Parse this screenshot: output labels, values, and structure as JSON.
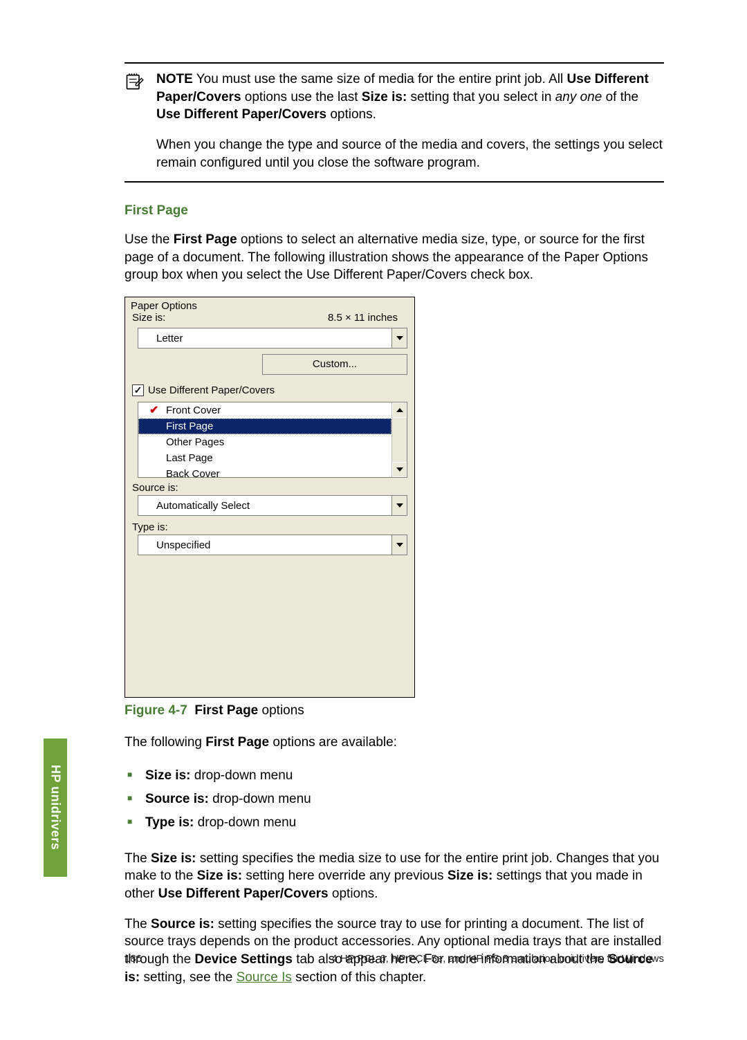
{
  "note": {
    "label": "NOTE",
    "para1_pre": "   You must use the same size of media for the entire print job. All ",
    "bold1": "Use Different Paper/Covers",
    "mid1": " options use the last ",
    "bold2": "Size is:",
    "mid2": " setting that you select in ",
    "ital1": "any one",
    "mid3": " of the ",
    "bold3": "Use Different Paper/Covers",
    "end1": " options.",
    "para2": "When you change the type and source of the media and covers, the settings you select remain configured until you close the software program."
  },
  "section": {
    "heading": "First Page"
  },
  "intro": {
    "pre": "Use the ",
    "b1": "First Page",
    "rest": " options to select an alternative media size, type, or source for the first page of a document. The following illustration shows the appearance of the Paper Options group box when you select the Use Different Paper/Covers check box."
  },
  "dialog": {
    "group": "Paper Options",
    "size_label": "Size is:",
    "size_dim": "8.5 × 11 inches",
    "size_value": "Letter",
    "custom_btn": "Custom...",
    "check_label": "Use Different Paper/Covers",
    "list": {
      "items": [
        "Front Cover",
        "First Page",
        "Other Pages",
        "Last Page",
        "Back Cover"
      ],
      "selected_index": 1,
      "checked_index": 0
    },
    "source_label": "Source is:",
    "source_value": "Automatically Select",
    "type_label": "Type is:",
    "type_value": "Unspecified"
  },
  "figure": {
    "label": "Figure 4-7",
    "title_bold": "First Page",
    "title_rest": " options"
  },
  "avail": {
    "pre": "The following ",
    "b1": "First Page",
    "rest": " options are available:"
  },
  "opts": {
    "i0b": "Size is:",
    "i0r": " drop-down menu",
    "i1b": "Source is:",
    "i1r": " drop-down menu",
    "i2b": "Type is:",
    "i2r": " drop-down menu"
  },
  "p_size": {
    "t0": "The ",
    "b0": "Size is:",
    "t1": " setting specifies the media size to use for the entire print job. Changes that you make to the ",
    "b1": "Size is:",
    "t2": " setting here override any previous ",
    "b2": "Size is:",
    "t3": " settings that you made in other ",
    "b3": "Use Different Paper/Covers",
    "t4": " options."
  },
  "p_source": {
    "t0": "The ",
    "b0": "Source is:",
    "t1": " setting specifies the source tray to use for printing a document. The list of source trays depends on the product accessories. Any optional media trays that are installed through the ",
    "b1": "Device Settings",
    "t2": " tab also appear here. For more information about the ",
    "b2": "Source is:",
    "t3": " setting, see the ",
    "link": "Source Is",
    "t4": " section of this chapter."
  },
  "sidetab": "HP unidrivers",
  "footer": {
    "page": "186",
    "chapter": "4   HP PCL 6, HP PCL 5e, and HP PS 3 emulation unidrivers for Windows"
  }
}
